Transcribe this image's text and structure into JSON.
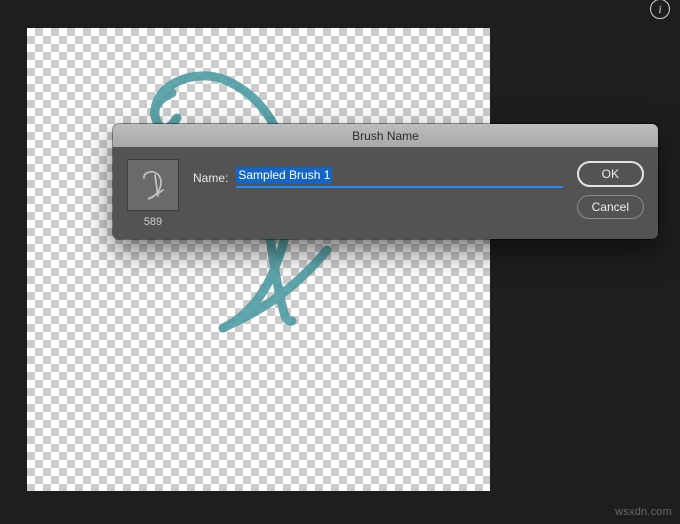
{
  "toolbar": {
    "info_glyph": "i"
  },
  "canvas": {
    "stroke_color": "#4e9ea5"
  },
  "dialog": {
    "title": "Brush Name",
    "preview_size": "589",
    "name_label": "Name:",
    "name_value": "Sampled Brush 1",
    "ok_label": "OK",
    "cancel_label": "Cancel"
  },
  "watermark": "wsxdn.com"
}
